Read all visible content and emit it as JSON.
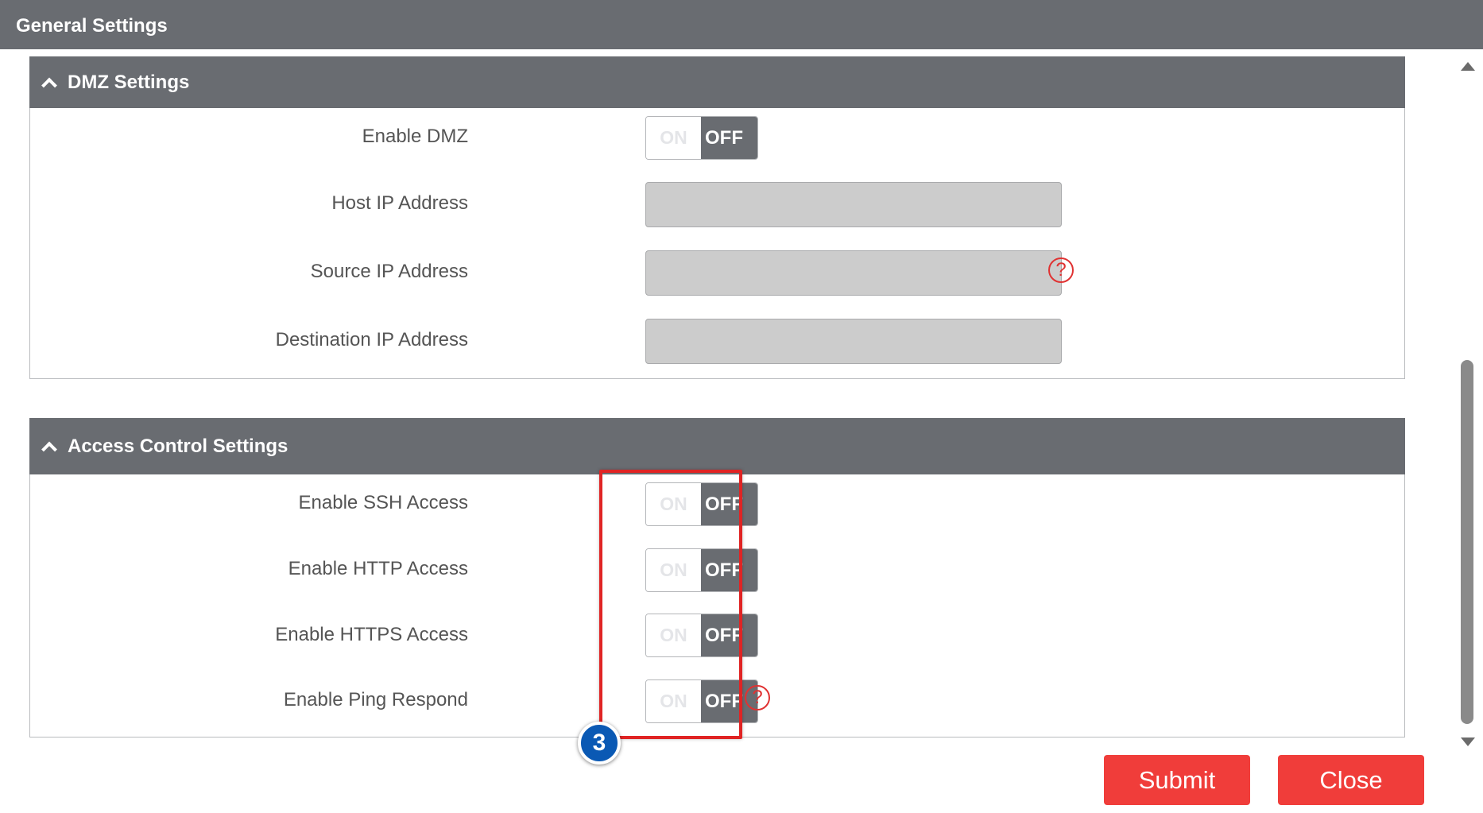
{
  "window": {
    "title": "General Settings"
  },
  "dmz": {
    "title": "DMZ Settings",
    "enable_label": "Enable DMZ",
    "enable_toggle": {
      "on": "ON",
      "off": "OFF",
      "state": "OFF"
    },
    "host_ip_label": "Host IP Address",
    "host_ip_value": "",
    "source_ip_label": "Source IP Address",
    "source_ip_value": "",
    "destination_ip_label": "Destination IP Address",
    "destination_ip_value": "",
    "help_symbol": "?"
  },
  "access_control": {
    "title": "Access Control Settings",
    "help_symbol": "?",
    "items": [
      {
        "label": "Enable SSH Access",
        "on": "ON",
        "off": "OFF",
        "state": "OFF"
      },
      {
        "label": "Enable HTTP Access",
        "on": "ON",
        "off": "OFF",
        "state": "OFF"
      },
      {
        "label": "Enable HTTPS Access",
        "on": "ON",
        "off": "OFF",
        "state": "OFF"
      },
      {
        "label": "Enable Ping Respond",
        "on": "ON",
        "off": "OFF",
        "state": "OFF"
      }
    ]
  },
  "annotation": {
    "step_number": "3",
    "highlight_color": "#e02424",
    "badge_color": "#0a59b4"
  },
  "buttons": {
    "submit": "Submit",
    "close": "Close"
  },
  "colors": {
    "header_bg": "#696c71",
    "button_bg": "#f03d3a",
    "help_color": "#e03232"
  },
  "icons": {
    "section_toggle": "chevron-up-icon",
    "help": "question-circle-icon",
    "scroll_up": "triangle-up-icon",
    "scroll_down": "triangle-down-icon"
  }
}
